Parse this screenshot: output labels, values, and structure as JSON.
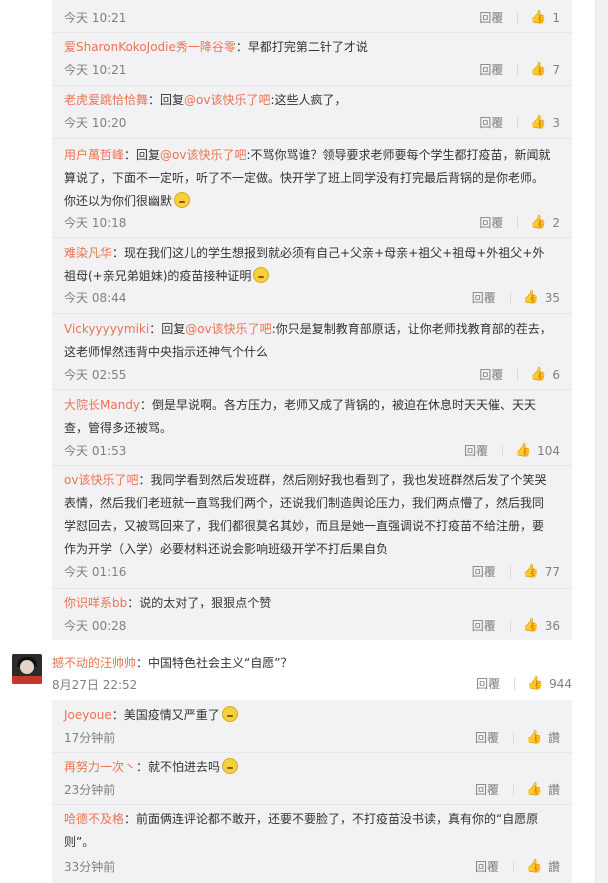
{
  "replies_top": [
    {
      "user": "",
      "text": "",
      "time": "今天 10:21",
      "reply": "回覆",
      "likes": "1"
    },
    {
      "user": "爱SharonKokoJodie秀一降谷零",
      "text": "：早都打完第二针了才说",
      "time": "今天 10:21",
      "reply": "回覆",
      "likes": "7"
    },
    {
      "user": "老虎爱跳恰恰舞",
      "pre": "：回复",
      "mention": "@ov该快乐了吧",
      "text": ":这些人疯了，",
      "time": "今天 10:20",
      "reply": "回覆",
      "likes": "3"
    },
    {
      "user": "用户萬哲峰",
      "pre": "：回复",
      "mention": "@ov该快乐了吧",
      "text": ":不骂你骂谁？领导要求老师要每个学生都打疫苗，新闻就算说了，下面不一定听，听了不一定做。快开学了班上同学没有打完最后背锅的是你老师。你还以为你们很幽默",
      "time": "今天 10:18",
      "reply": "回覆",
      "likes": "2"
    },
    {
      "user": "难染凡华",
      "text": "：现在我们这儿的学生想报到就必须有自己+父亲+母亲+祖父+祖母+外祖父+外祖母(+亲兄弟姐妹)的疫苗接种证明",
      "time": "今天 08:44",
      "reply": "回覆",
      "likes": "35"
    },
    {
      "user": "Vickyyyyymiki",
      "pre": "：回复",
      "mention": "@ov该快乐了吧",
      "text": ":你只是复制教育部原话，让你老师找教育部的茬去，这老师悍然违背中央指示还神气个什么",
      "time": "今天 02:55",
      "reply": "回覆",
      "likes": "6"
    },
    {
      "user": "大院长Mandy",
      "text": "：倒是早说啊。各方压力，老师又成了背锅的，被迫在休息时天天催、天天查，管得多还被骂。",
      "time": "今天 01:53",
      "reply": "回覆",
      "likes": "104"
    },
    {
      "user": "ov该快乐了吧",
      "text": "：我同学看到然后发班群，然后刚好我也看到了，我也发班群然后发了个笑哭表情，然后我们老班就一直骂我们两个，还说我们制造舆论压力，我们两点懵了，然后我同学怼回去，又被骂回来了，我们都很莫名其妙，而且是她一直强调说不打疫苗不给注册，要作为开学（入学）必要材料还说会影响班级开学不打后果自负",
      "time": "今天 01:16",
      "reply": "回覆",
      "likes": "77"
    },
    {
      "user": "你识咩系bb",
      "text": "：说的太对了，狠狠点个赞",
      "time": "今天 00:28",
      "reply": "回覆",
      "likes": "36"
    }
  ],
  "main_comment": {
    "user": "撼不动的汪帅帅",
    "text": "：中国特色社会主义“自愿”？",
    "time": "8月27日 22:52",
    "reply": "回覆",
    "likes": "944"
  },
  "replies_bottom": [
    {
      "user": "Joeyoue",
      "text": "：美国疫情又严重了",
      "time": "17分钟前",
      "reply": "回覆",
      "likes": "讚"
    },
    {
      "user": "再努力一次丶",
      "text": "：就不怕进去吗",
      "time": "23分钟前",
      "reply": "回覆",
      "likes": "讚"
    },
    {
      "user": "哈德不及格",
      "text": "：前面俩连评论都不敢开，还要不要脸了，不打疫苗没书读，真有你的“自愿原则”。",
      "time": "33分钟前",
      "reply": "回覆",
      "likes": "讚"
    }
  ],
  "colors": {
    "username": "#eb7350",
    "reply_bg": "#f2f2f5",
    "muted": "#808080"
  }
}
